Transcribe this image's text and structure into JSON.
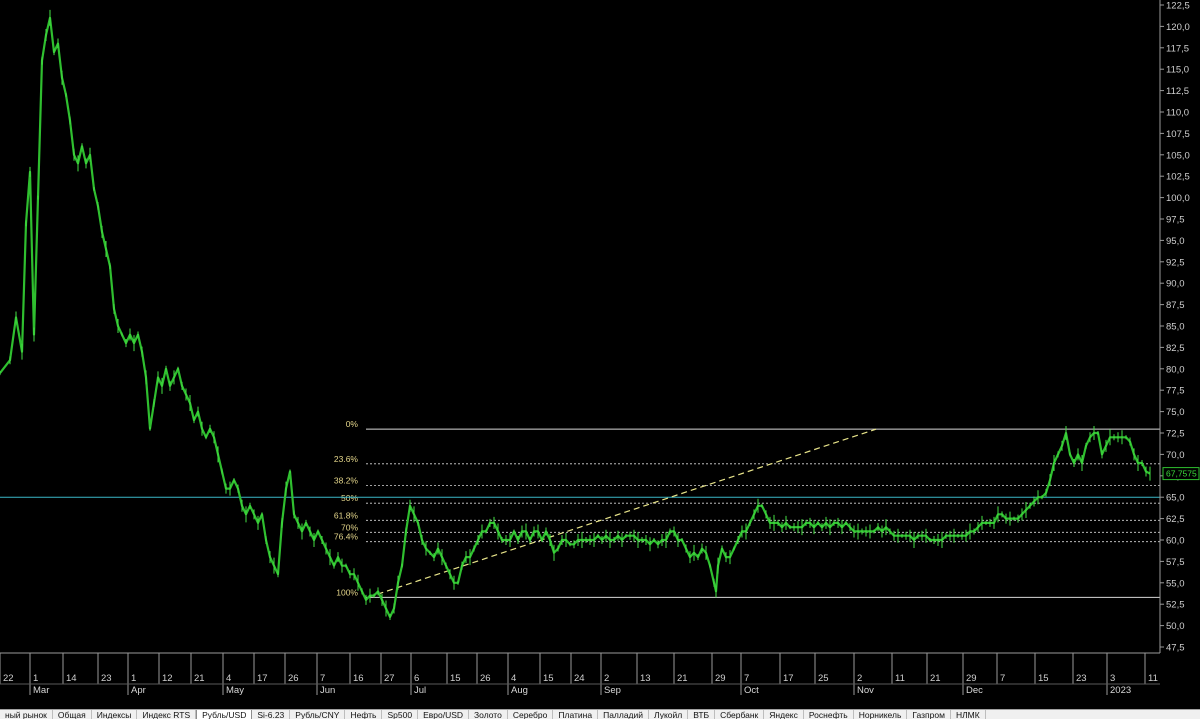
{
  "colors": {
    "background": "#000000",
    "price": "#2fbf2f",
    "price_bright": "#45e045",
    "axis": "#9a9a9a",
    "fib_level": "#d8d8d8",
    "fib_label": "#e3d58a",
    "trend": "#e8e48a",
    "horizontal": "#3ab8c8"
  },
  "chart_data": {
    "type": "line",
    "ylim": [
      47.5,
      122.5
    ],
    "y_ticks": [
      "122,5",
      "120,0",
      "117,5",
      "115,0",
      "112,5",
      "110,0",
      "107,5",
      "105,0",
      "102,5",
      "100,0",
      "97,5",
      "95,0",
      "92,5",
      "90,0",
      "87,5",
      "85,0",
      "82,5",
      "80,0",
      "77,5",
      "75,0",
      "72,5",
      "70,0",
      "67,5",
      "65,0",
      "62,5",
      "60,0",
      "57,5",
      "55,0",
      "52,5",
      "50,0",
      "47,5"
    ],
    "x_ticks": [
      "22",
      "1",
      "14",
      "23",
      "1",
      "12",
      "21",
      "4",
      "17",
      "26",
      "7",
      "16",
      "27",
      "6",
      "15",
      "26",
      "4",
      "15",
      "24",
      "2",
      "13",
      "21",
      "29",
      "7",
      "17",
      "25",
      "2",
      "11",
      "21",
      "29",
      "7",
      "15",
      "23",
      "3",
      "11"
    ],
    "months": [
      "Mar",
      "Apr",
      "May",
      "Jun",
      "Jul",
      "Aug",
      "Sep",
      "Oct",
      "Nov",
      "Dec",
      "2023"
    ],
    "series": [
      {
        "points": [
          [
            0,
            79.5
          ],
          [
            10,
            81
          ],
          [
            16,
            86
          ],
          [
            22,
            82
          ],
          [
            26,
            97
          ],
          [
            30,
            103
          ],
          [
            34,
            84
          ],
          [
            38,
            100
          ],
          [
            42,
            116
          ],
          [
            46,
            119
          ],
          [
            50,
            121
          ],
          [
            54,
            117
          ],
          [
            58,
            118
          ],
          [
            62,
            114
          ],
          [
            66,
            112
          ],
          [
            70,
            109
          ],
          [
            74,
            105
          ],
          [
            78,
            104
          ],
          [
            82,
            106
          ],
          [
            86,
            104
          ],
          [
            90,
            105
          ],
          [
            94,
            101
          ],
          [
            98,
            99
          ],
          [
            102,
            96
          ],
          [
            106,
            94
          ],
          [
            110,
            92
          ],
          [
            114,
            87
          ],
          [
            118,
            85
          ],
          [
            122,
            84
          ],
          [
            126,
            83
          ],
          [
            130,
            84
          ],
          [
            134,
            83
          ],
          [
            138,
            84
          ],
          [
            142,
            82
          ],
          [
            146,
            79
          ],
          [
            150,
            73
          ],
          [
            154,
            76
          ],
          [
            158,
            79
          ],
          [
            162,
            78
          ],
          [
            166,
            80
          ],
          [
            170,
            78
          ],
          [
            174,
            79
          ],
          [
            178,
            80
          ],
          [
            182,
            78
          ],
          [
            186,
            77
          ],
          [
            190,
            76
          ],
          [
            194,
            74
          ],
          [
            198,
            75
          ],
          [
            202,
            73
          ],
          [
            206,
            72
          ],
          [
            210,
            73
          ],
          [
            214,
            72
          ],
          [
            218,
            70
          ],
          [
            222,
            68
          ],
          [
            226,
            66
          ],
          [
            230,
            66
          ],
          [
            234,
            67
          ],
          [
            238,
            66
          ],
          [
            242,
            64
          ],
          [
            246,
            63
          ],
          [
            250,
            64
          ],
          [
            254,
            63
          ],
          [
            258,
            62
          ],
          [
            262,
            63
          ],
          [
            266,
            60
          ],
          [
            270,
            58
          ],
          [
            274,
            57
          ],
          [
            278,
            56
          ],
          [
            282,
            62
          ],
          [
            286,
            66
          ],
          [
            290,
            68
          ],
          [
            294,
            63
          ],
          [
            298,
            62
          ],
          [
            302,
            61
          ],
          [
            306,
            62
          ],
          [
            310,
            61
          ],
          [
            314,
            60
          ],
          [
            318,
            61
          ],
          [
            322,
            60
          ],
          [
            326,
            59
          ],
          [
            330,
            58
          ],
          [
            334,
            57
          ],
          [
            338,
            58
          ],
          [
            342,
            57
          ],
          [
            346,
            57
          ],
          [
            350,
            56
          ],
          [
            354,
            56
          ],
          [
            358,
            55
          ],
          [
            362,
            54
          ],
          [
            366,
            53
          ],
          [
            370,
            53.5
          ],
          [
            374,
            53.5
          ],
          [
            378,
            54
          ],
          [
            382,
            53
          ],
          [
            386,
            52
          ],
          [
            390,
            51
          ],
          [
            394,
            52
          ],
          [
            398,
            55
          ],
          [
            402,
            57
          ],
          [
            406,
            61
          ],
          [
            410,
            64
          ],
          [
            414,
            63
          ],
          [
            418,
            62
          ],
          [
            422,
            60
          ],
          [
            426,
            59
          ],
          [
            430,
            58.5
          ],
          [
            434,
            58
          ],
          [
            438,
            59
          ],
          [
            442,
            58
          ],
          [
            446,
            57
          ],
          [
            450,
            56
          ],
          [
            454,
            55
          ],
          [
            458,
            55
          ],
          [
            462,
            57
          ],
          [
            466,
            58
          ],
          [
            470,
            58
          ],
          [
            474,
            59
          ],
          [
            478,
            60
          ],
          [
            482,
            61
          ],
          [
            486,
            61
          ],
          [
            490,
            62
          ],
          [
            494,
            62
          ],
          [
            498,
            61
          ],
          [
            502,
            60
          ],
          [
            506,
            60
          ],
          [
            510,
            60
          ],
          [
            514,
            61
          ],
          [
            518,
            60
          ],
          [
            522,
            61
          ],
          [
            526,
            61
          ],
          [
            530,
            60
          ],
          [
            534,
            61
          ],
          [
            538,
            61
          ],
          [
            542,
            60
          ],
          [
            546,
            61
          ],
          [
            550,
            60
          ],
          [
            554,
            58.5
          ],
          [
            558,
            59
          ],
          [
            562,
            60
          ],
          [
            566,
            60
          ],
          [
            570,
            59.5
          ],
          [
            574,
            59.5
          ],
          [
            578,
            60
          ],
          [
            582,
            60
          ],
          [
            586,
            60
          ],
          [
            590,
            60
          ],
          [
            594,
            60
          ],
          [
            598,
            60.5
          ],
          [
            602,
            60
          ],
          [
            606,
            60.5
          ],
          [
            610,
            60
          ],
          [
            614,
            60
          ],
          [
            618,
            60.5
          ],
          [
            622,
            60
          ],
          [
            626,
            60.5
          ],
          [
            630,
            60.5
          ],
          [
            634,
            60.5
          ],
          [
            638,
            60
          ],
          [
            642,
            60
          ],
          [
            646,
            60
          ],
          [
            650,
            59.5
          ],
          [
            654,
            60
          ],
          [
            658,
            59.5
          ],
          [
            662,
            60
          ],
          [
            666,
            60
          ],
          [
            670,
            61
          ],
          [
            674,
            61
          ],
          [
            678,
            60
          ],
          [
            682,
            60
          ],
          [
            686,
            59
          ],
          [
            690,
            58
          ],
          [
            694,
            58.5
          ],
          [
            698,
            58
          ],
          [
            702,
            59
          ],
          [
            706,
            58.5
          ],
          [
            710,
            57
          ],
          [
            714,
            55
          ],
          [
            716,
            54
          ],
          [
            718,
            57
          ],
          [
            722,
            59
          ],
          [
            726,
            58
          ],
          [
            730,
            58
          ],
          [
            734,
            59
          ],
          [
            738,
            60
          ],
          [
            742,
            61
          ],
          [
            746,
            61
          ],
          [
            750,
            62
          ],
          [
            754,
            63
          ],
          [
            758,
            64
          ],
          [
            762,
            64
          ],
          [
            766,
            63
          ],
          [
            770,
            62
          ],
          [
            774,
            62
          ],
          [
            778,
            62
          ],
          [
            782,
            61.5
          ],
          [
            786,
            62
          ],
          [
            790,
            61.5
          ],
          [
            794,
            61.5
          ],
          [
            798,
            61.5
          ],
          [
            802,
            61.5
          ],
          [
            806,
            62
          ],
          [
            810,
            62
          ],
          [
            814,
            61.5
          ],
          [
            818,
            62
          ],
          [
            822,
            61.5
          ],
          [
            826,
            62
          ],
          [
            830,
            61.5
          ],
          [
            834,
            62
          ],
          [
            838,
            62
          ],
          [
            842,
            61.5
          ],
          [
            846,
            62
          ],
          [
            850,
            61.5
          ],
          [
            854,
            61
          ],
          [
            858,
            61
          ],
          [
            862,
            61
          ],
          [
            866,
            61
          ],
          [
            870,
            61
          ],
          [
            874,
            61
          ],
          [
            878,
            61.5
          ],
          [
            882,
            61
          ],
          [
            886,
            61.5
          ],
          [
            890,
            61
          ],
          [
            894,
            60.5
          ],
          [
            898,
            60.5
          ],
          [
            902,
            60.5
          ],
          [
            906,
            60.5
          ],
          [
            910,
            60.5
          ],
          [
            914,
            60
          ],
          [
            918,
            60.5
          ],
          [
            922,
            60.5
          ],
          [
            926,
            60.5
          ],
          [
            930,
            60
          ],
          [
            934,
            60
          ],
          [
            938,
            60
          ],
          [
            942,
            60
          ],
          [
            946,
            60.5
          ],
          [
            950,
            60.5
          ],
          [
            954,
            60.5
          ],
          [
            958,
            60.5
          ],
          [
            962,
            60.5
          ],
          [
            966,
            60.5
          ],
          [
            970,
            61
          ],
          [
            974,
            61
          ],
          [
            978,
            61.5
          ],
          [
            982,
            62
          ],
          [
            986,
            62
          ],
          [
            990,
            62
          ],
          [
            994,
            62
          ],
          [
            998,
            63
          ],
          [
            1002,
            63
          ],
          [
            1006,
            62.5
          ],
          [
            1010,
            62.5
          ],
          [
            1014,
            62.5
          ],
          [
            1018,
            62.5
          ],
          [
            1022,
            63
          ],
          [
            1026,
            63.5
          ],
          [
            1030,
            64
          ],
          [
            1034,
            64.5
          ],
          [
            1038,
            65
          ],
          [
            1042,
            65
          ],
          [
            1046,
            65.5
          ],
          [
            1050,
            67
          ],
          [
            1054,
            69
          ],
          [
            1058,
            70
          ],
          [
            1062,
            71
          ],
          [
            1066,
            72.5
          ],
          [
            1070,
            70
          ],
          [
            1074,
            69
          ],
          [
            1078,
            70
          ],
          [
            1082,
            69
          ],
          [
            1086,
            71
          ],
          [
            1090,
            72
          ],
          [
            1094,
            72.5
          ],
          [
            1098,
            72.5
          ],
          [
            1102,
            70
          ],
          [
            1106,
            71
          ],
          [
            1110,
            72
          ],
          [
            1114,
            72
          ],
          [
            1118,
            72
          ],
          [
            1122,
            72
          ],
          [
            1126,
            72
          ],
          [
            1130,
            71.5
          ],
          [
            1134,
            70
          ],
          [
            1138,
            69
          ],
          [
            1142,
            69
          ],
          [
            1146,
            68
          ],
          [
            1150,
            67.7575
          ]
        ]
      }
    ],
    "last_price": "67,7575",
    "fib_levels": [
      {
        "label": "0%",
        "value": 72.95
      },
      {
        "label": "23.6%",
        "value": 68.9
      },
      {
        "label": "38.2%",
        "value": 66.35
      },
      {
        "label": "50%",
        "value": 64.3
      },
      {
        "label": "61.8%",
        "value": 62.3
      },
      {
        "label": "70%",
        "value": 60.9
      },
      {
        "label": "76.4%",
        "value": 59.8
      },
      {
        "label": "100%",
        "value": 53.3
      }
    ],
    "horizontal_line": 65.0,
    "grid": false
  },
  "tabs": [
    {
      "label": "ный рынок",
      "active": false
    },
    {
      "label": "Общая",
      "active": false
    },
    {
      "label": "Индексы",
      "active": false
    },
    {
      "label": "Индекс RTS",
      "active": false
    },
    {
      "label": "Рубль/USD",
      "active": true
    },
    {
      "label": "Si-6.23",
      "active": false
    },
    {
      "label": "Рубль/CNY",
      "active": false
    },
    {
      "label": "Нефть",
      "active": false
    },
    {
      "label": "Sp500",
      "active": false
    },
    {
      "label": "Евро/USD",
      "active": false
    },
    {
      "label": "Золото",
      "active": false
    },
    {
      "label": "Серебро",
      "active": false
    },
    {
      "label": "Платина",
      "active": false
    },
    {
      "label": "Палладий",
      "active": false
    },
    {
      "label": "Лукойл",
      "active": false
    },
    {
      "label": "ВТБ",
      "active": false
    },
    {
      "label": "Сбербанк",
      "active": false
    },
    {
      "label": "Яндекс",
      "active": false
    },
    {
      "label": "Роснефть",
      "active": false
    },
    {
      "label": "Норникель",
      "active": false
    },
    {
      "label": "Газпром",
      "active": false
    },
    {
      "label": "НЛМК",
      "active": false
    }
  ]
}
